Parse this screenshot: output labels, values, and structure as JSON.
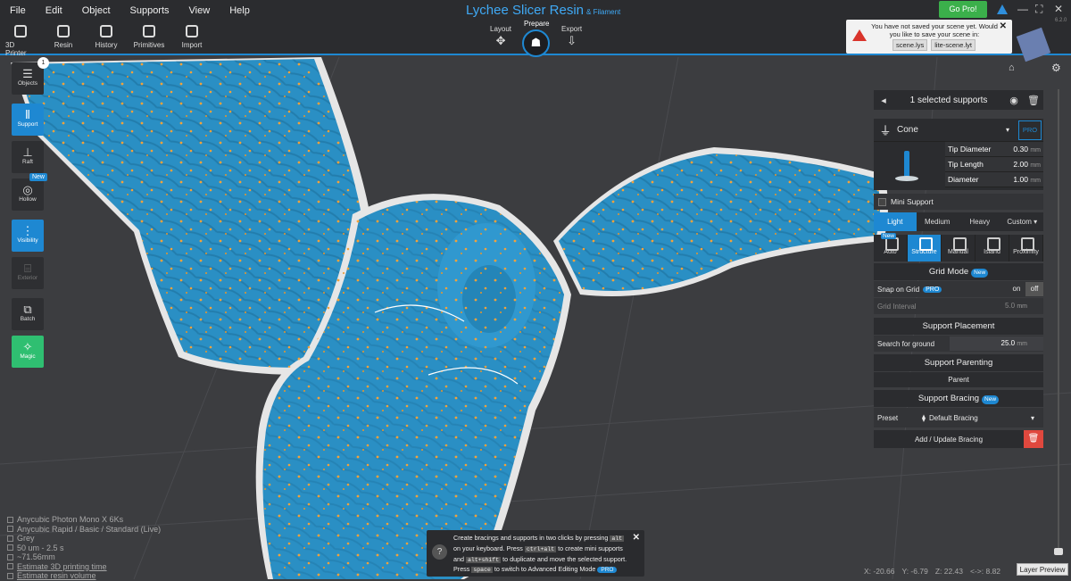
{
  "menu": [
    "File",
    "Edit",
    "Object",
    "Supports",
    "View",
    "Help"
  ],
  "tools": [
    "3D Printer",
    "Resin",
    "History",
    "Primitives",
    "Import"
  ],
  "title": {
    "main": "Lychee Slicer Resin",
    "sub": "& Filament"
  },
  "modes": {
    "layout": "Layout",
    "prepare": "Prepare",
    "export": "Export"
  },
  "gopro": "Go Pro!",
  "version": "6.2.0",
  "notification": {
    "text": "You have not saved your scene yet. Would you like to save your scene in:",
    "opt1": "scene.lys",
    "opt2": "lite-scene.lyt"
  },
  "left": {
    "objects": "Objects",
    "objects_count": "1",
    "support": "Support",
    "raft": "Raft",
    "hollow": "Hollow",
    "hollow_new": "New",
    "visibility": "Visibility",
    "exterior": "Exterior",
    "batch": "Batch",
    "magic": "Magic"
  },
  "panel": {
    "selected": "1 selected supports",
    "type": "Cone",
    "pro": "PRO",
    "tip_diameter": {
      "label": "Tip Diameter",
      "value": "0.30",
      "unit": "mm"
    },
    "tip_length": {
      "label": "Tip Length",
      "value": "2.00",
      "unit": "mm"
    },
    "diameter": {
      "label": "Diameter",
      "value": "1.00",
      "unit": "mm"
    },
    "mini": "Mini Support",
    "density": [
      "Light",
      "Medium",
      "Heavy",
      "Custom ▾"
    ],
    "modes": [
      "Auto",
      "Structure",
      "Manual",
      "Island",
      "Proximity"
    ],
    "modes_new": "New",
    "grid_mode": "Grid Mode",
    "new": "New",
    "snap": "Snap on Grid",
    "on": "on",
    "off": "off",
    "grid_interval": {
      "label": "Grid Interval",
      "value": "5.0",
      "unit": "mm"
    },
    "placement": "Support Placement",
    "search": {
      "label": "Search for ground",
      "value": "25.0",
      "unit": "mm"
    },
    "parenting": "Support Parenting",
    "parent": "Parent",
    "bracing": "Support Bracing",
    "preset_label": "Preset",
    "preset_value": "Default Bracing",
    "add": "Add / Update Bracing"
  },
  "info": [
    "Anycubic Photon Mono X 6Ks",
    "Anycubic Rapid / Basic / Standard (Live)",
    "Grey",
    "50 um - 2.5 s",
    "~71.56mm",
    "Estimate 3D printing time",
    "Estimate resin volume"
  ],
  "tip": {
    "a": "Create bracings and supports in two clicks by pressing",
    "k1": "alt",
    "b": "on your keyboard. Press",
    "k2": "ctrl+alt",
    "c": "to create mini supports and",
    "k3": "alt+shift",
    "d": "to duplicate and move the selected support. Press",
    "k4": "space",
    "e": "to switch to Advanced Editing Mode",
    "pro": "PRO"
  },
  "coords": {
    "x": "X: -20.66",
    "y": "Y: -6.79",
    "z": "Z: 22.43",
    "d": "<->: 8.82"
  },
  "layer_preview": "Layer Preview",
  "colors": {
    "accent": "#1e88d2",
    "model": "#2a8fc4",
    "go_pro": "#3bb04b",
    "magic": "#2fbf71"
  }
}
